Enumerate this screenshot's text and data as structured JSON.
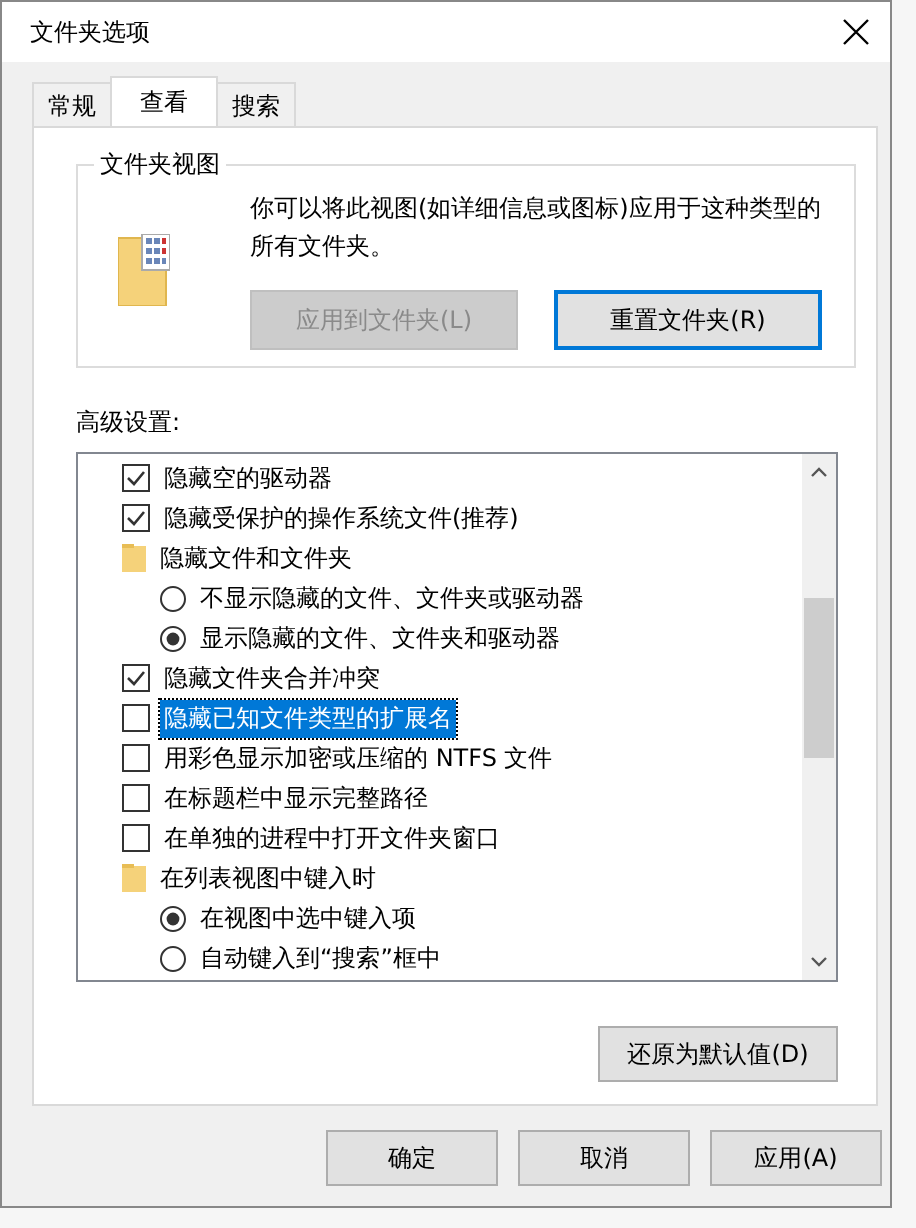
{
  "window": {
    "title": "文件夹选项"
  },
  "tabs": [
    {
      "label": "常规",
      "selected": false
    },
    {
      "label": "查看",
      "selected": true
    },
    {
      "label": "搜索",
      "selected": false
    }
  ],
  "folder_view": {
    "title": "文件夹视图",
    "description": "你可以将此视图(如详细信息或图标)应用于这种类型的所有文件夹。",
    "buttons": [
      {
        "label": "应用到文件夹(L)",
        "disabled": true
      },
      {
        "label": "重置文件夹(R)",
        "disabled": false
      }
    ]
  },
  "advanced": {
    "label": "高级设置:",
    "items": [
      {
        "kind": "checkbox",
        "label": "隐藏空的驱动器",
        "checked": true,
        "selected": false
      },
      {
        "kind": "checkbox",
        "label": "隐藏受保护的操作系统文件(推荐)",
        "checked": true,
        "selected": false
      },
      {
        "kind": "folder",
        "label": "隐藏文件和文件夹",
        "selected": false,
        "children": [
          {
            "kind": "radio",
            "label": "不显示隐藏的文件、文件夹或驱动器",
            "checked": false,
            "selected": false
          },
          {
            "kind": "radio",
            "label": "显示隐藏的文件、文件夹和驱动器",
            "checked": true,
            "selected": false
          }
        ]
      },
      {
        "kind": "checkbox",
        "label": "隐藏文件夹合并冲突",
        "checked": true,
        "selected": false
      },
      {
        "kind": "checkbox",
        "label": "隐藏已知文件类型的扩展名",
        "checked": false,
        "selected": true
      },
      {
        "kind": "checkbox",
        "label": "用彩色显示加密或压缩的 NTFS 文件",
        "checked": false,
        "selected": false
      },
      {
        "kind": "checkbox",
        "label": "在标题栏中显示完整路径",
        "checked": false,
        "selected": false
      },
      {
        "kind": "checkbox",
        "label": "在单独的进程中打开文件夹窗口",
        "checked": false,
        "selected": false
      },
      {
        "kind": "folder",
        "label": "在列表视图中键入时",
        "selected": false,
        "children": [
          {
            "kind": "radio",
            "label": "在视图中选中键入项",
            "checked": true,
            "selected": false
          },
          {
            "kind": "radio",
            "label": "自动键入到“搜索”框中",
            "checked": false,
            "selected": false
          }
        ]
      }
    ],
    "restore_button": "还原为默认值(D)"
  },
  "buttons": [
    "确定",
    "取消",
    "应用(A)"
  ]
}
